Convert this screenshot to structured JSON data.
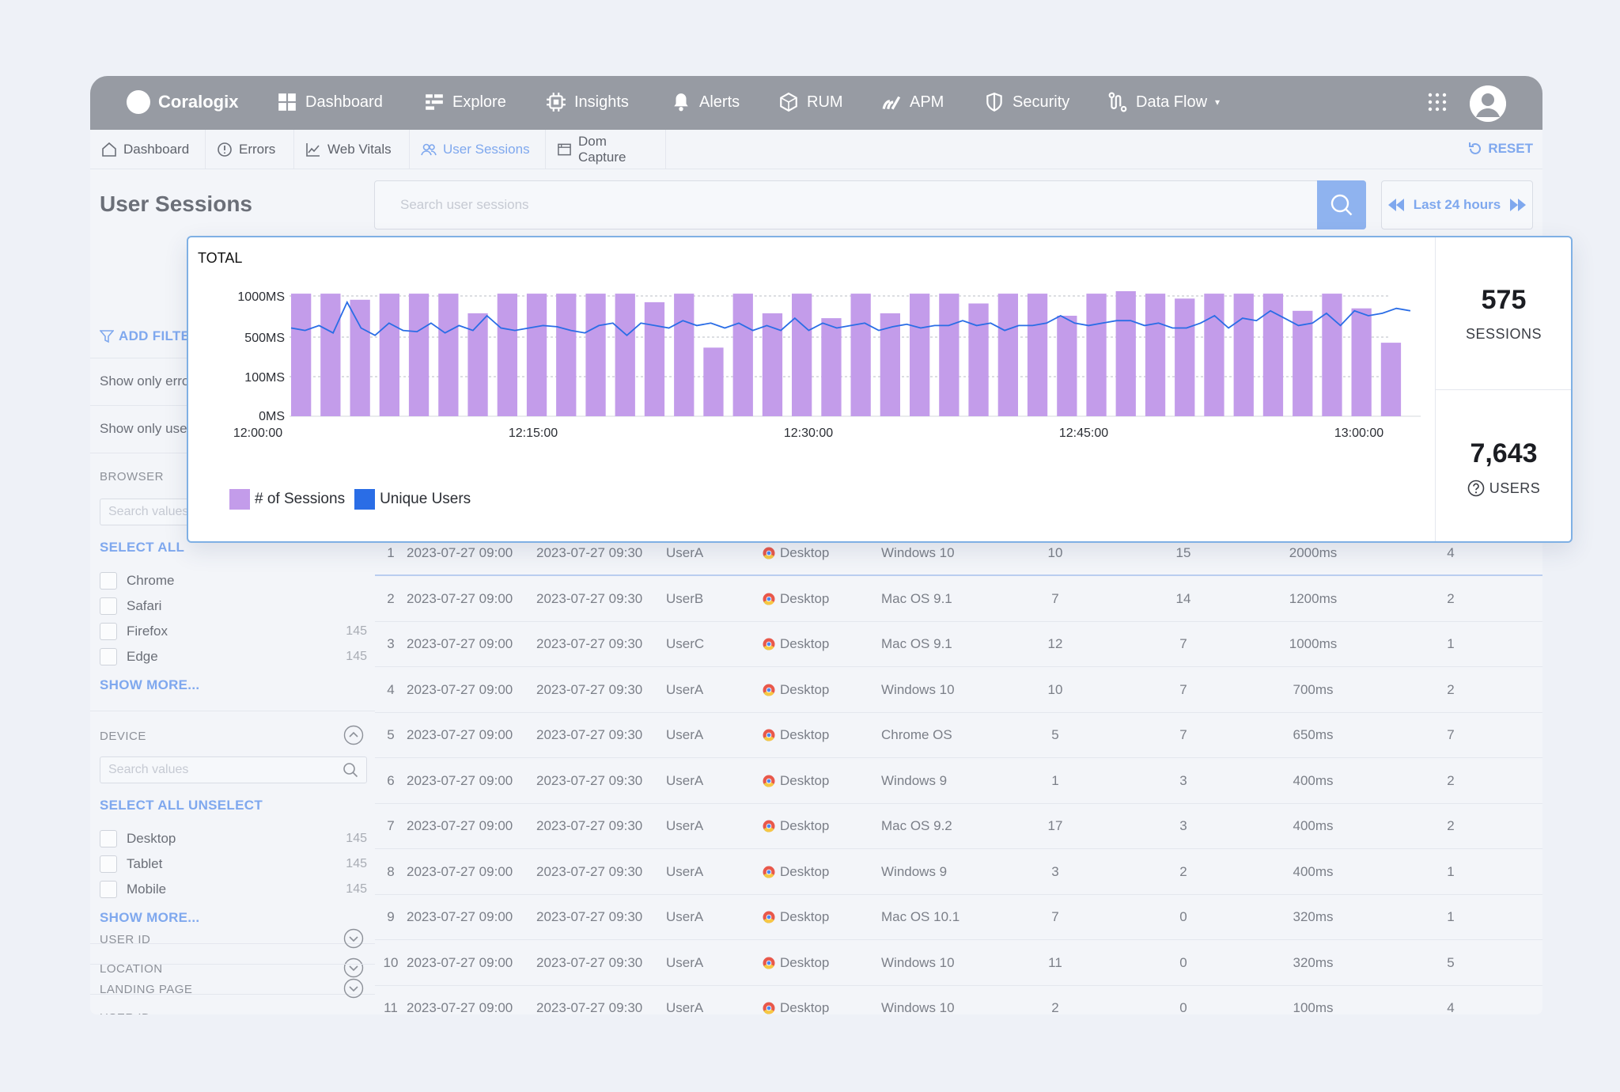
{
  "app": {
    "name": "Coralogix"
  },
  "nav": {
    "items": [
      {
        "label": "Dashboard",
        "icon": "dashboard-icon"
      },
      {
        "label": "Explore",
        "icon": "explore-icon"
      },
      {
        "label": "Insights",
        "icon": "insights-icon"
      },
      {
        "label": "Alerts",
        "icon": "bell-icon"
      },
      {
        "label": "RUM",
        "icon": "rum-icon"
      },
      {
        "label": "APM",
        "icon": "apm-icon"
      },
      {
        "label": "Security",
        "icon": "shield-icon"
      },
      {
        "label": "Data Flow",
        "icon": "data-flow-icon"
      }
    ]
  },
  "subtabs": {
    "items": [
      {
        "label": "Dashboard"
      },
      {
        "label": "Errors"
      },
      {
        "label": "Web Vitals"
      },
      {
        "label": "User Sessions"
      },
      {
        "label": "Dom Capture"
      }
    ],
    "active": "User Sessions",
    "reset_label": "RESET"
  },
  "page": {
    "title": "User Sessions"
  },
  "search": {
    "placeholder": "Search user sessions",
    "value": ""
  },
  "time_range": {
    "label": "Last 24 hours"
  },
  "sidebar": {
    "add_filter": "ADD FILTER",
    "show_only_errors": "Show only errors",
    "show_only_users": "Show only users",
    "browser": {
      "heading": "BROWSER",
      "search_placeholder": "Search values",
      "select_all": "SELECT ALL",
      "options": [
        {
          "label": "Chrome",
          "count": ""
        },
        {
          "label": "Safari",
          "count": ""
        },
        {
          "label": "Firefox",
          "count": "145"
        },
        {
          "label": "Edge",
          "count": "145"
        }
      ],
      "show_more": "SHOW MORE..."
    },
    "device": {
      "heading": "DEVICE",
      "search_placeholder": "Search values",
      "select_all": "SELECT ALL",
      "unselect": "UNSELECT",
      "options": [
        {
          "label": "Desktop",
          "count": "145"
        },
        {
          "label": "Tablet",
          "count": "145"
        },
        {
          "label": "Mobile",
          "count": "145"
        }
      ],
      "show_more": "SHOW MORE..."
    },
    "location": {
      "heading": "LOCATION"
    },
    "user_id": {
      "heading": "USER ID"
    },
    "landing_page": {
      "heading": "LANDING PAGE"
    }
  },
  "table": {
    "rows": [
      [
        "1",
        "2023-07-27 09:00",
        "2023-07-27 09:30",
        "UserA",
        "Desktop",
        "Windows 10",
        "10",
        "15",
        "2000ms",
        "4"
      ],
      [
        "2",
        "2023-07-27 09:00",
        "2023-07-27 09:30",
        "UserB",
        "Desktop",
        "Mac OS 9.1",
        "7",
        "14",
        "1200ms",
        "2"
      ],
      [
        "3",
        "2023-07-27 09:00",
        "2023-07-27 09:30",
        "UserC",
        "Desktop",
        "Mac OS 9.1",
        "12",
        "7",
        "1000ms",
        "1"
      ],
      [
        "4",
        "2023-07-27 09:00",
        "2023-07-27 09:30",
        "UserA",
        "Desktop",
        "Windows 10",
        "10",
        "7",
        "700ms",
        "2"
      ],
      [
        "5",
        "2023-07-27 09:00",
        "2023-07-27 09:30",
        "UserA",
        "Desktop",
        "Chrome OS",
        "5",
        "7",
        "650ms",
        "7"
      ],
      [
        "6",
        "2023-07-27 09:00",
        "2023-07-27 09:30",
        "UserA",
        "Desktop",
        "Windows 9",
        "1",
        "3",
        "400ms",
        "2"
      ],
      [
        "7",
        "2023-07-27 09:00",
        "2023-07-27 09:30",
        "UserA",
        "Desktop",
        "Mac OS 9.2",
        "17",
        "3",
        "400ms",
        "2"
      ],
      [
        "8",
        "2023-07-27 09:00",
        "2023-07-27 09:30",
        "UserA",
        "Desktop",
        "Windows 9",
        "3",
        "2",
        "400ms",
        "1"
      ],
      [
        "9",
        "2023-07-27 09:00",
        "2023-07-27 09:30",
        "UserA",
        "Desktop",
        "Mac OS 10.1",
        "7",
        "0",
        "320ms",
        "1"
      ],
      [
        "10",
        "2023-07-27 09:00",
        "2023-07-27 09:30",
        "UserA",
        "Desktop",
        "Windows 10",
        "11",
        "0",
        "320ms",
        "5"
      ],
      [
        "11",
        "2023-07-27 09:00",
        "2023-07-27 09:30",
        "UserA",
        "Desktop",
        "Windows 10",
        "2",
        "0",
        "100ms",
        "4"
      ]
    ]
  },
  "summary": {
    "title": "TOTAL",
    "sessions_value": "575",
    "sessions_label": "SESSIONS",
    "users_value": "7,643",
    "users_label": "USERS"
  },
  "chart_data": {
    "type": "bar",
    "title": "TOTAL",
    "y_ticks": [
      "1000MS",
      "500MS",
      "100MS",
      "0MS"
    ],
    "x_ticks": [
      "12:00:00",
      "12:15:00",
      "12:30:00",
      "12:45:00",
      "13:00:00"
    ],
    "grid": true,
    "legend_position": "bottom-left",
    "series": [
      {
        "name": "# of Sessions",
        "type": "bar",
        "color": "#c39cea",
        "values": [
          1000,
          1000,
          950,
          1000,
          1000,
          1000,
          840,
          1000,
          1000,
          1000,
          1000,
          1000,
          930,
          1000,
          560,
          1000,
          840,
          1000,
          800,
          1000,
          840,
          1000,
          1000,
          920,
          1000,
          1000,
          820,
          1000,
          1020,
          1000,
          960,
          1000,
          1000,
          1000,
          860,
          1000,
          880,
          600
        ]
      },
      {
        "name": "Unique Users",
        "type": "line",
        "color": "#2a6de6",
        "values": [
          720,
          700,
          740,
          680,
          930,
          720,
          660,
          760,
          700,
          690,
          760,
          680,
          740,
          700,
          820,
          720,
          700,
          720,
          740,
          730,
          700,
          680,
          740,
          760,
          660,
          760,
          740,
          720,
          780,
          740,
          760,
          720,
          760,
          700,
          740,
          700,
          800,
          700,
          760,
          720,
          740,
          760,
          700,
          730,
          750,
          720,
          740,
          740,
          780,
          740,
          760,
          700,
          740,
          740,
          760,
          820,
          760,
          740,
          760,
          780,
          780,
          740,
          760,
          720,
          720,
          760,
          820,
          720,
          800,
          780,
          860,
          800,
          740,
          760,
          840,
          740,
          860,
          820,
          840,
          880,
          860
        ]
      }
    ]
  }
}
